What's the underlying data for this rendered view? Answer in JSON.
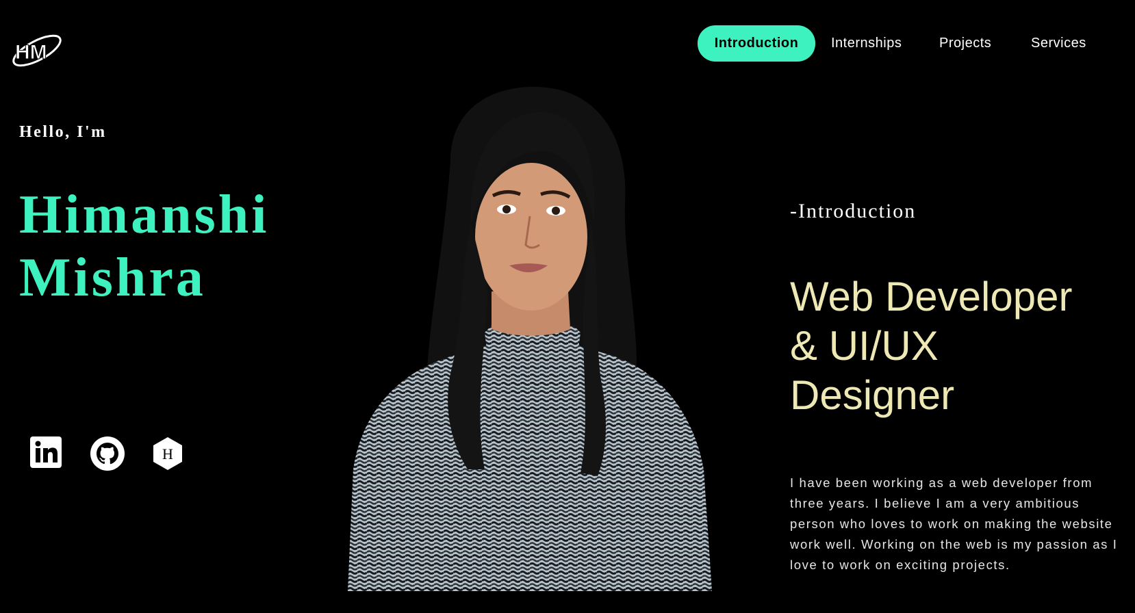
{
  "logo": {
    "text": "HM",
    "icon": "hm-logo-icon"
  },
  "nav": {
    "items": [
      {
        "label": "Introduction",
        "active": true
      },
      {
        "label": "Internships",
        "active": false
      },
      {
        "label": "Projects",
        "active": false
      },
      {
        "label": "Services",
        "active": false
      }
    ]
  },
  "hero": {
    "greeting": "Hello, I'm",
    "first_name": "Himanshi",
    "last_name": "Mishra"
  },
  "social": [
    {
      "icon": "linkedin-icon"
    },
    {
      "icon": "github-icon"
    },
    {
      "icon": "hashnode-icon"
    }
  ],
  "intro": {
    "label": "-Introduction",
    "headline_lines": [
      "Web Developer",
      "& UI/UX",
      "Designer"
    ],
    "description": "I have been working as a web developer from three years. I believe I am a very ambitious person who loves to work on making the website work well. Working on the web is my passion as I love to work on exciting projects."
  },
  "colors": {
    "accent": "#3ef2c0",
    "headline": "#ede8b4",
    "background": "#000000",
    "text": "#ffffff"
  }
}
